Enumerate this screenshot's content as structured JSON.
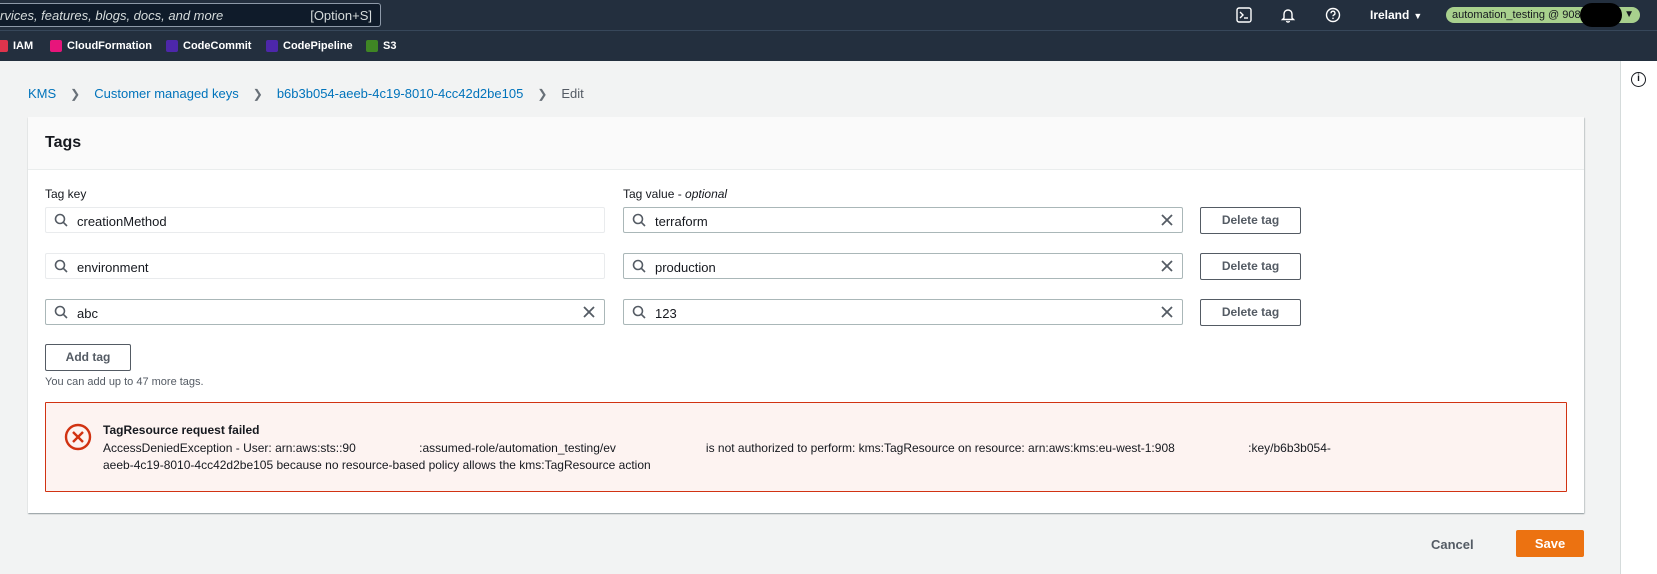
{
  "topnav": {
    "search_placeholder": "rvices, features, blogs, docs, and more",
    "search_shortcut": "[Option+S]",
    "region": "Ireland",
    "account": "automation_testing @ 908"
  },
  "favorites": [
    {
      "label": "IAM",
      "color": "#dd344c"
    },
    {
      "label": "CloudFormation",
      "color": "#e7157b"
    },
    {
      "label": "CodeCommit",
      "color": "#4d27aa"
    },
    {
      "label": "CodePipeline",
      "color": "#4d27aa"
    },
    {
      "label": "S3",
      "color": "#3f8624"
    }
  ],
  "breadcrumb": {
    "items": [
      "KMS",
      "Customer managed keys",
      "b6b3b054-aeeb-4c19-8010-4cc42d2be105"
    ],
    "current": "Edit"
  },
  "panel": {
    "title": "Tags",
    "tag_key_label": "Tag key",
    "tag_value_label": "Tag value - ",
    "tag_value_optional": "optional",
    "tags": [
      {
        "key": "creationMethod",
        "value": "terraform"
      },
      {
        "key": "environment",
        "value": "production"
      },
      {
        "key": "abc",
        "value": "123"
      }
    ],
    "delete_label": "Delete tag",
    "add_label": "Add tag",
    "hint": "You can add up to 47 more tags."
  },
  "alert": {
    "title": "TagResource request failed",
    "message_line1": "AccessDeniedException - User: arn:aws:sts::90                   :assumed-role/automation_testing/ev                           is not authorized to perform: kms:TagResource on resource: arn:aws:kms:eu-west-1:908                      :key/b6b3b054-",
    "message_line2": "aeeb-4c19-8010-4cc42d2be105 because no resource-based policy allows the kms:TagResource action"
  },
  "footer": {
    "cancel_label": "Cancel",
    "save_label": "Save"
  },
  "colors": {
    "nav_bg": "#232f3e",
    "link": "#0073bb",
    "primary": "#ec7211",
    "error": "#d13212"
  }
}
